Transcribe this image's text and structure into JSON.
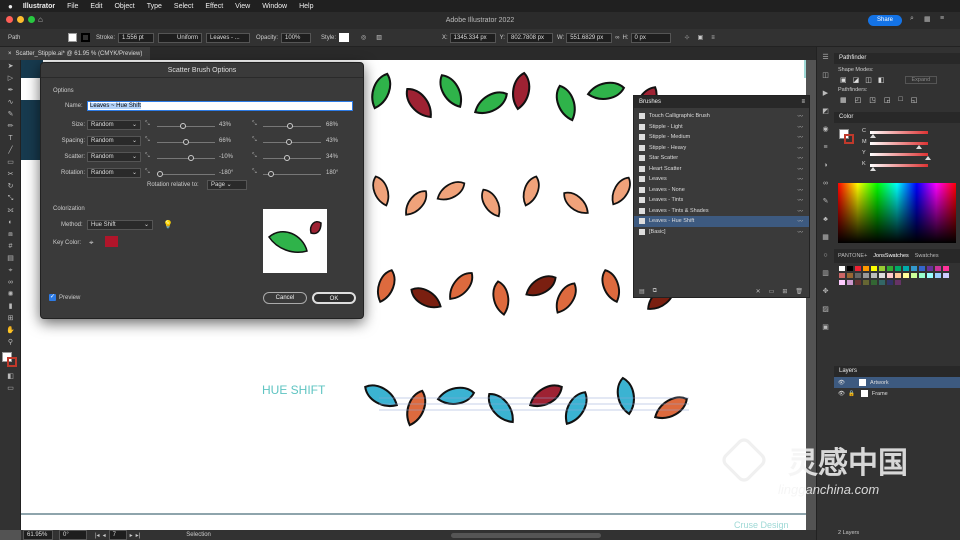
{
  "menubar": {
    "apple": "",
    "app": "Illustrator",
    "items": [
      "File",
      "Edit",
      "Object",
      "Type",
      "Select",
      "Effect",
      "View",
      "Window",
      "Help"
    ]
  },
  "titlebar": {
    "title": "Adobe Illustrator 2022",
    "share": "Share"
  },
  "control": {
    "path": "Path",
    "stroke_label": "Stroke:",
    "stroke_value": "1.556 pt",
    "profile": "Uniform",
    "brush": "Leaves - ...",
    "opacity_label": "Opacity:",
    "opacity": "100%",
    "style_label": "Style:",
    "x": "1345.334 px",
    "y": "802.7808 px",
    "w": "551.6829 px",
    "h": "0 px"
  },
  "doc_tab": "Scatter_Stipple.ai* @ 61.95 % (CMYK/Preview)",
  "status": {
    "zoom": "61.95%",
    "angle": "0°",
    "page": "7",
    "tool": "Selection"
  },
  "canvas": {
    "hue_shift_label": "HUE SHIFT",
    "footer": "Cruse Design"
  },
  "dialog": {
    "title": "Scatter Brush Options",
    "options_label": "Options",
    "name_label": "Name:",
    "name_value": "Leaves ~ Hue Shift",
    "rows": [
      {
        "label": "Size:",
        "mode": "Random",
        "v1": "43%",
        "v2": "68%"
      },
      {
        "label": "Spacing:",
        "mode": "Random",
        "v1": "66%",
        "v2": "43%"
      },
      {
        "label": "Scatter:",
        "mode": "Random",
        "v1": "-10%",
        "v2": "34%"
      },
      {
        "label": "Rotation:",
        "mode": "Random",
        "v1": "-180°",
        "v2": "180°"
      }
    ],
    "rotation_rel_label": "Rotation relative to:",
    "rotation_rel": "Page",
    "colorization_label": "Colorization",
    "method_label": "Method:",
    "method": "Hue Shift",
    "key_color_label": "Key Color:",
    "key_color": "#b0152a",
    "preview_label": "Preview",
    "cancel": "Cancel",
    "ok": "OK"
  },
  "brushes_panel": {
    "title": "Brushes",
    "items": [
      "Touch Calligraphic Brush",
      "Stipple - Light",
      "Stipple - Medium",
      "Stipple - Heavy",
      "Star Scatter",
      "Heart Scatter",
      "Leaves",
      "Leaves - None",
      "Leaves - Tints",
      "Leaves - Tints & Shades",
      "Leaves - Hue Shift",
      "[Basic]"
    ],
    "selected_index": 10
  },
  "pathfinder": {
    "title": "Pathfinder",
    "shape_modes": "Shape Modes:",
    "pathfinders": "Pathfinders:",
    "expand": "Expand"
  },
  "color": {
    "title": "Color",
    "c": "C",
    "m": "M",
    "y": "Y",
    "k": "K",
    "m_val": "80",
    "y_val": "95",
    "c_fill": 0.0,
    "m_fill": 0.8,
    "y_fill": 0.95,
    "k_fill": 0.0
  },
  "swatches": {
    "tabs": [
      "PANTONE+",
      "JonsSwatches",
      "Swatches"
    ]
  },
  "layers": {
    "title": "Layers",
    "items": [
      "Artwork",
      "Frame"
    ],
    "footer": "2 Layers"
  },
  "watermark": {
    "cn": "灵感中国",
    "url": "lingganchina.com"
  },
  "colors": {
    "green": "#2fb34a",
    "red": "#9e2233",
    "salmon": "#f0a27a",
    "orange": "#dd6a3e",
    "cyan": "#3bb3d2",
    "brown": "#7a1f10"
  }
}
